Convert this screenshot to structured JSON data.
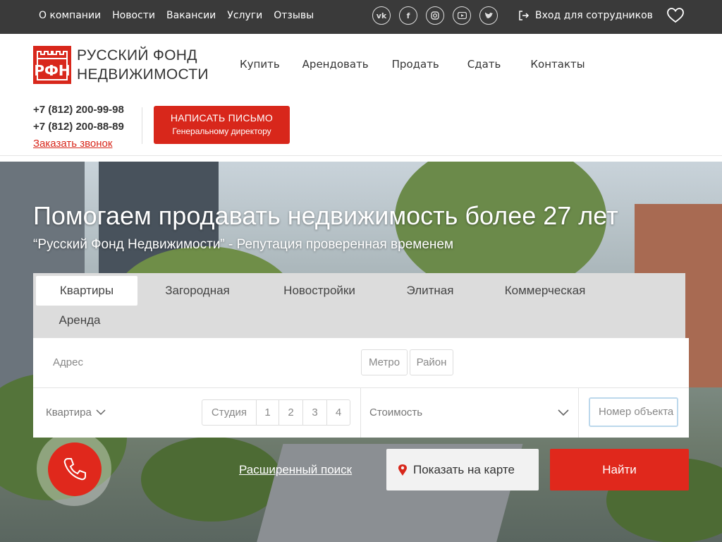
{
  "topbar": {
    "nav": [
      "О компании",
      "Новости",
      "Вакансии",
      "Услуги",
      "Отзывы"
    ],
    "social_icons": [
      "vk-icon",
      "facebook-icon",
      "instagram-icon",
      "youtube-icon",
      "twitter-icon"
    ],
    "login_label": "Вход для сотрудников"
  },
  "header": {
    "logo_line1": "РУССКИЙ ФОНД",
    "logo_line2": "НЕДВИЖИМОСТИ",
    "nav": [
      "Купить",
      "Арендовать",
      "Продать",
      "Сдать",
      "Контакты"
    ],
    "phone1": "+7 (812) 200-99-98",
    "phone2": "+7 (812) 200-88-89",
    "callback": "Заказать звонок",
    "letter_line1": "НАПИСАТЬ ПИСЬМО",
    "letter_line2": "Генеральному директору"
  },
  "hero": {
    "title": "Помогаем продавать недвижимость более 27 лет",
    "subtitle": "“Русский Фонд Недвижимости” - Репутация проверенная временем"
  },
  "search": {
    "tabs": [
      "Квартиры",
      "Загородная",
      "Новостройки",
      "Элитная",
      "Коммерческая",
      "Аренда"
    ],
    "address_placeholder": "Адрес",
    "metro": "Метро",
    "district": "Район",
    "type_label": "Квартира",
    "rooms": [
      "Студия",
      "1",
      "2",
      "3",
      "4"
    ],
    "price_label": "Стоимость",
    "object_number_placeholder": "Номер объекта",
    "advanced": "Расширенный поиск",
    "show_on_map": "Показать на карте",
    "find": "Найти"
  },
  "colors": {
    "brand_red": "#d8271b",
    "topbar": "#3a3a3a"
  }
}
